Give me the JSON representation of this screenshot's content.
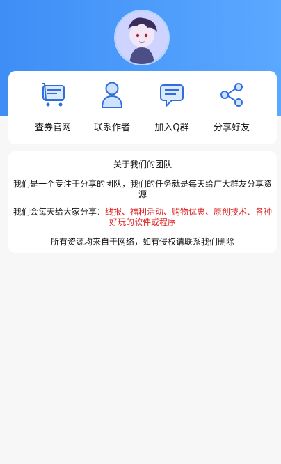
{
  "header": {
    "avatar_alt": "",
    "colors": {
      "gradient_start": "#3e8ef6",
      "gradient_end": "#5aa8ff"
    }
  },
  "actions": [
    {
      "label": "查券官网",
      "icon": "cart-screen-icon"
    },
    {
      "label": "联系作者",
      "icon": "user-icon"
    },
    {
      "label": "加入Q群",
      "icon": "chat-icon"
    },
    {
      "label": "分享好友",
      "icon": "share-icon"
    }
  ],
  "about": {
    "title": "关于我们的团队",
    "intro": "我们是一个专注于分享的团队，我们的任务就是每天给广大群友分享资源",
    "share_prefix": "我们会每天给大家分享：",
    "share_items": "线报、福利活动、购物优惠、原创技术、各种好玩的软件或程序",
    "disclaimer": "所有资源均来自于网络，如有侵权请联系我们删除"
  }
}
